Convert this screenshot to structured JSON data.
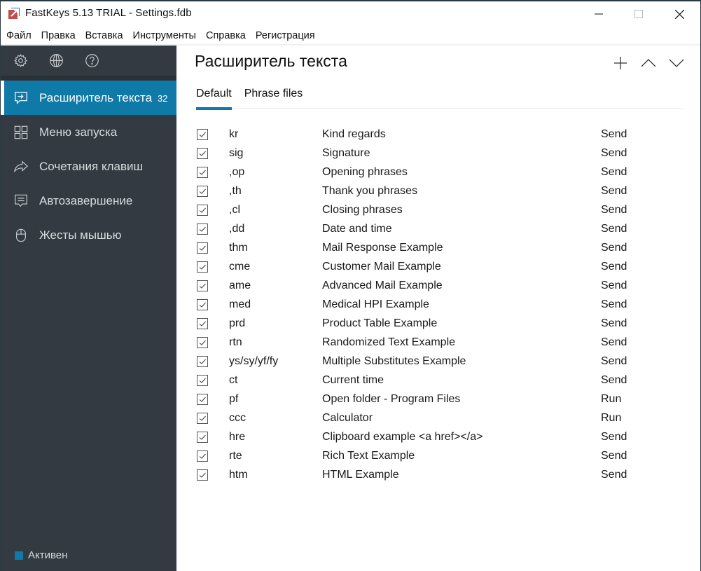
{
  "window": {
    "title": "FastKeys 5.13 TRIAL - Settings.fdb",
    "controls": {
      "minimize": "minimize",
      "maximize": "maximize",
      "close": "close"
    }
  },
  "menu": [
    "Файл",
    "Правка",
    "Вставка",
    "Инструменты",
    "Справка",
    "Регистрация"
  ],
  "sidebar": {
    "tools": [
      {
        "icon": "gear-icon",
        "label": "Settings"
      },
      {
        "icon": "globe-icon",
        "label": "Web"
      },
      {
        "icon": "help-icon",
        "label": "Help"
      }
    ],
    "items": [
      {
        "label": "Расширитель текста",
        "badge": "32",
        "icon": "text-expander-icon",
        "active": true
      },
      {
        "label": "Меню запуска",
        "badge": "",
        "icon": "grid-icon",
        "active": false
      },
      {
        "label": "Сочетания клавиш",
        "badge": "",
        "icon": "share-arrow-icon",
        "active": false
      },
      {
        "label": "Автозавершение",
        "badge": "",
        "icon": "comment-lines-icon",
        "active": false
      },
      {
        "label": "Жесты мышью",
        "badge": "",
        "icon": "mouse-icon",
        "active": false
      }
    ],
    "status": {
      "label": "Активен",
      "color": "#0f79a8"
    }
  },
  "main": {
    "title": "Расширитель текста",
    "toolbar": {
      "add": "+",
      "up": "up",
      "down": "down"
    },
    "tabs": [
      {
        "label": "Default",
        "active": true
      },
      {
        "label": "Phrase files",
        "active": false
      }
    ],
    "phrases": [
      {
        "checked": true,
        "abbr": "kr",
        "desc": "Kind regards",
        "action": "Send"
      },
      {
        "checked": true,
        "abbr": "sig",
        "desc": "Signature",
        "action": "Send"
      },
      {
        "checked": true,
        "abbr": ",op",
        "desc": "Opening phrases",
        "action": "Send"
      },
      {
        "checked": true,
        "abbr": ",th",
        "desc": "Thank you phrases",
        "action": "Send"
      },
      {
        "checked": true,
        "abbr": ",cl",
        "desc": "Closing phrases",
        "action": "Send"
      },
      {
        "checked": true,
        "abbr": ",dd",
        "desc": "Date and time",
        "action": "Send"
      },
      {
        "checked": true,
        "abbr": "thm",
        "desc": "Mail Response Example",
        "action": "Send"
      },
      {
        "checked": true,
        "abbr": "cme",
        "desc": "Customer Mail Example",
        "action": "Send"
      },
      {
        "checked": true,
        "abbr": "ame",
        "desc": "Advanced Mail Example",
        "action": "Send"
      },
      {
        "checked": true,
        "abbr": "med",
        "desc": "Medical HPI Example",
        "action": "Send"
      },
      {
        "checked": true,
        "abbr": "prd",
        "desc": "Product Table Example",
        "action": "Send"
      },
      {
        "checked": true,
        "abbr": "rtn",
        "desc": "Randomized Text Example",
        "action": "Send"
      },
      {
        "checked": true,
        "abbr": "ys/sy/yf/fy",
        "desc": "Multiple Substitutes Example",
        "action": "Send"
      },
      {
        "checked": true,
        "abbr": "ct",
        "desc": "Current time",
        "action": "Send"
      },
      {
        "checked": true,
        "abbr": "pf",
        "desc": "Open folder - Program Files",
        "action": "Run"
      },
      {
        "checked": true,
        "abbr": "ccc",
        "desc": "Calculator",
        "action": "Run"
      },
      {
        "checked": true,
        "abbr": "hre",
        "desc": "Clipboard example <a href></a>",
        "action": "Send"
      },
      {
        "checked": true,
        "abbr": "rte",
        "desc": "Rich Text Example",
        "action": "Send"
      },
      {
        "checked": true,
        "abbr": "htm",
        "desc": "HTML Example",
        "action": "Send"
      }
    ]
  },
  "colors": {
    "accent": "#0f79a8",
    "sidebar": "#333a41",
    "sidebar_divider": "#2a3036"
  }
}
